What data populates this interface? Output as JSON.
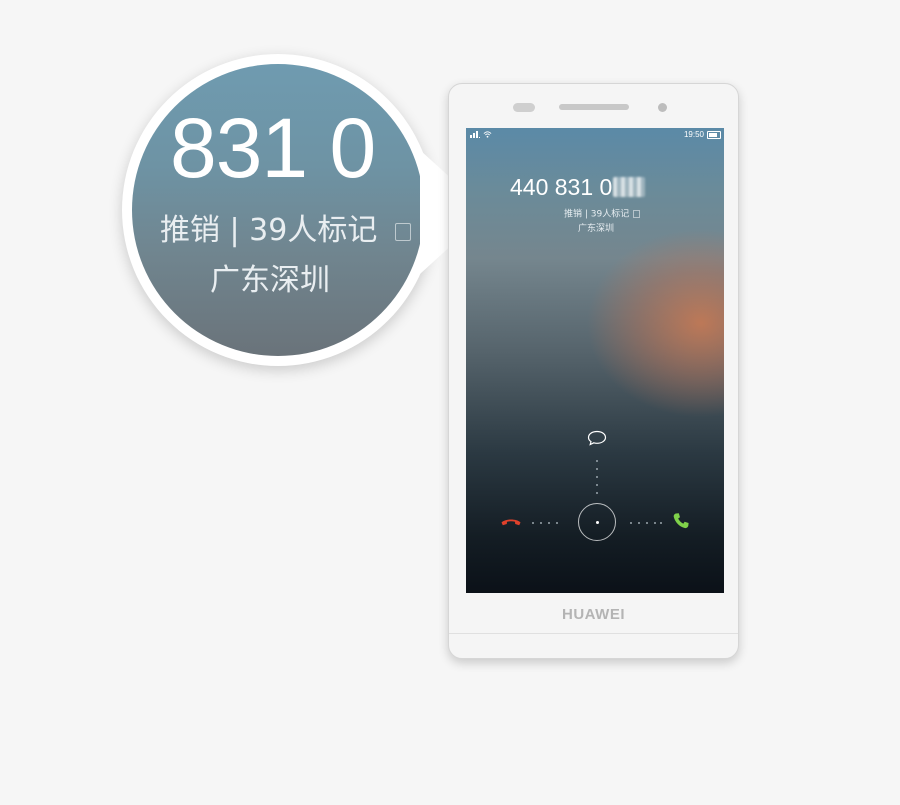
{
  "magnifier": {
    "number": "831 0",
    "tag": "推销 | 39人标记",
    "location": "广东深圳"
  },
  "phone": {
    "brand": "HUAWEI",
    "status_bar": {
      "time": "19:50"
    },
    "caller": {
      "number": "440 831 0",
      "tag": "推销 | 39人标记",
      "location": "广东深圳"
    },
    "actions": {
      "decline_icon": "phone-hangup-icon",
      "accept_icon": "phone-answer-icon",
      "message_icon": "message-bubble-icon"
    },
    "colors": {
      "decline": "#e0412b",
      "accept": "#7fd14a"
    }
  }
}
